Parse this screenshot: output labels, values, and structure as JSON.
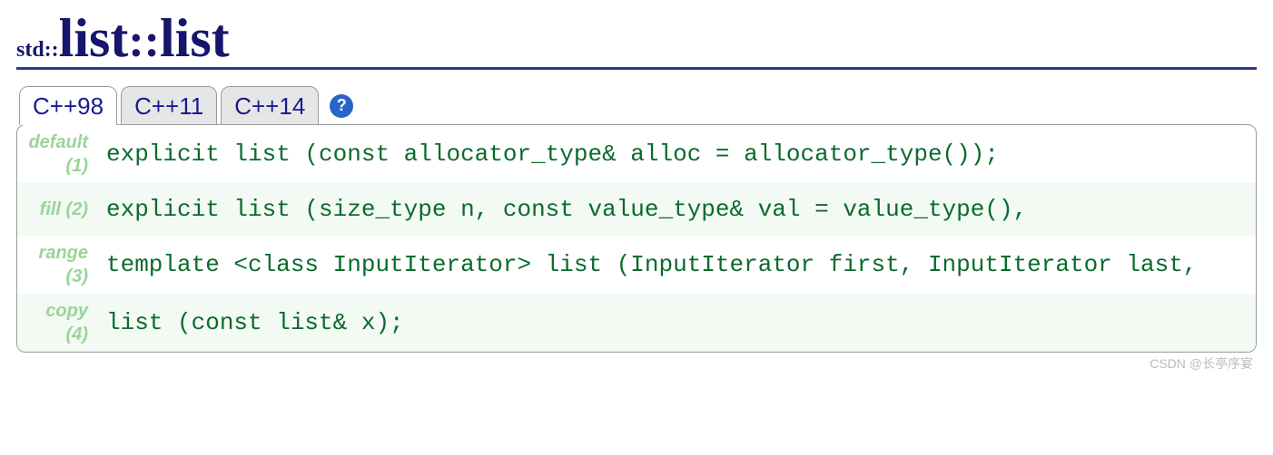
{
  "title": {
    "namespace": "std::",
    "class": "list",
    "separator": "::",
    "member": "list"
  },
  "tabs": [
    {
      "label": "C++98",
      "active": true
    },
    {
      "label": "C++11",
      "active": false
    },
    {
      "label": "C++14",
      "active": false
    }
  ],
  "help_icon_glyph": "?",
  "signatures": [
    {
      "tag": "default (1)",
      "code": "explicit list (const allocator_type& alloc = allocator_type());"
    },
    {
      "tag": "fill (2)",
      "code": "explicit list (size_type n, const value_type& val = value_type(),"
    },
    {
      "tag": "range (3)",
      "code": "template <class InputIterator>  list (InputIterator first, InputIterator last,"
    },
    {
      "tag": "copy (4)",
      "code": "list (const list& x);"
    }
  ],
  "watermark": "CSDN @长亭序宴"
}
